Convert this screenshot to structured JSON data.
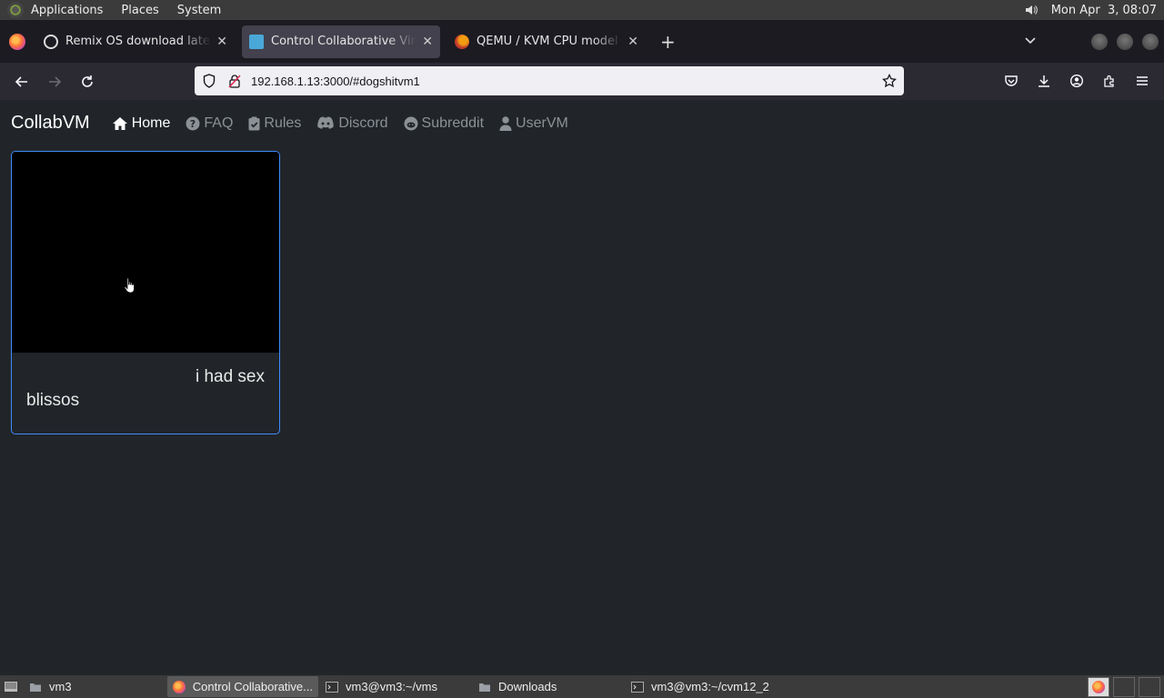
{
  "desktop": {
    "menus": [
      "Applications",
      "Places",
      "System"
    ],
    "clock": "Mon Apr  3, 08:07"
  },
  "browser": {
    "tabs": [
      {
        "title": "Remix OS download latest v",
        "favicon": "circle-icon",
        "active": false
      },
      {
        "title": "Control Collaborative Virtual",
        "favicon": "monitor-icon",
        "active": true
      },
      {
        "title": "QEMU / KVM CPU model c",
        "favicon": "qemu-icon",
        "active": false
      }
    ],
    "url": "192.168.1.13:3000/#dogshitvm1"
  },
  "site": {
    "brand": "CollabVM",
    "nav": [
      {
        "label": "Home",
        "icon": "home-icon",
        "active": true
      },
      {
        "label": "FAQ",
        "icon": "question-icon",
        "active": false
      },
      {
        "label": "Rules",
        "icon": "clipboard-check-icon",
        "active": false
      },
      {
        "label": "Discord",
        "icon": "discord-icon",
        "active": false
      },
      {
        "label": "Subreddit",
        "icon": "reddit-icon",
        "active": false
      },
      {
        "label": "UserVM",
        "icon": "user-icon",
        "active": false
      }
    ],
    "vm_card": {
      "caption_line1": "i had sex",
      "caption_line2": "blissos"
    }
  },
  "taskbar": {
    "items": [
      {
        "label": "vm3",
        "icon": "folder-icon"
      },
      {
        "label": "Control Collaborative...",
        "icon": "firefox-icon",
        "active": true
      },
      {
        "label": "vm3@vm3:~/vms",
        "icon": "terminal-icon"
      },
      {
        "label": "Downloads",
        "icon": "folder-icon"
      },
      {
        "label": "vm3@vm3:~/cvm12_2",
        "icon": "terminal-icon"
      }
    ]
  }
}
